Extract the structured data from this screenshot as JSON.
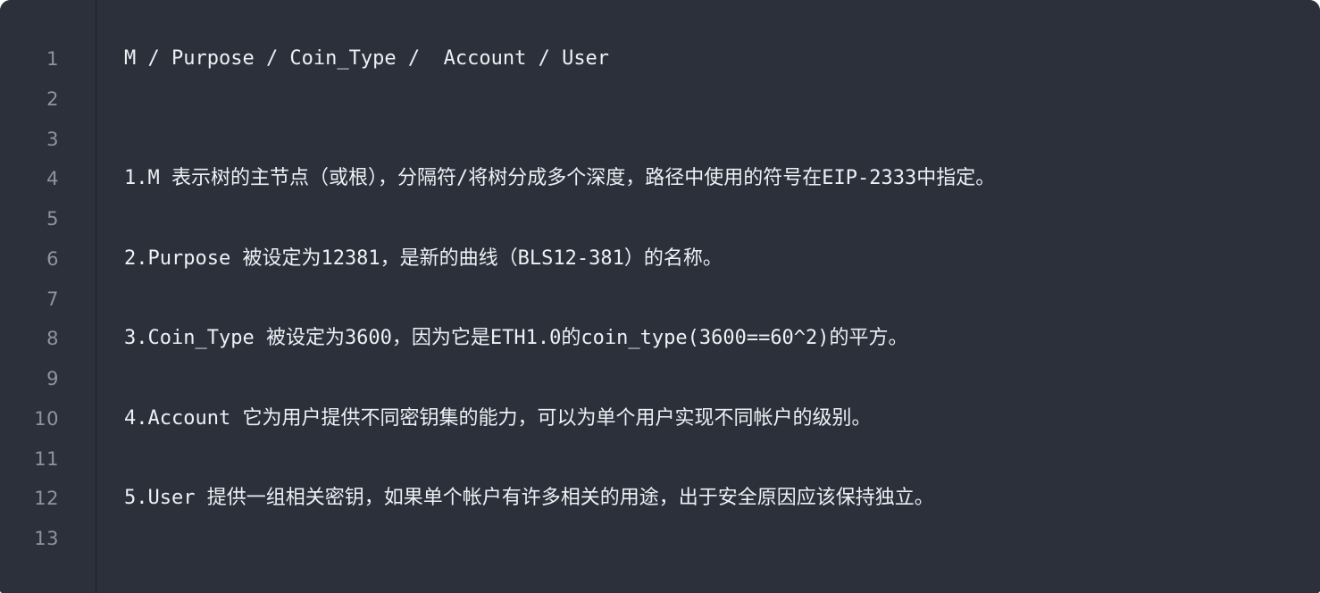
{
  "editor": {
    "background_color": "#2b303b",
    "gutter_divider_color": "#1b1f27",
    "text_color": "#edf0f4",
    "line_number_color": "#8d94a1",
    "gutter": {
      "line_numbers": [
        "1",
        "2",
        "3",
        "4",
        "5",
        "6",
        "7",
        "8",
        "9",
        "10",
        "11",
        "12",
        "13"
      ]
    },
    "lines": [
      {
        "number": "1",
        "text": "M / Purpose / Coin_Type /  Account / User"
      },
      {
        "number": "2",
        "text": ""
      },
      {
        "number": "3",
        "text": ""
      },
      {
        "number": "4",
        "text": "1.M 表示树的主节点（或根），分隔符/将树分成多个深度，路径中使用的符号在EIP-2333中指定。"
      },
      {
        "number": "5",
        "text": ""
      },
      {
        "number": "6",
        "text": "2.Purpose 被设定为12381，是新的曲线（BLS12-381）的名称。"
      },
      {
        "number": "7",
        "text": ""
      },
      {
        "number": "8",
        "text": "3.Coin_Type 被设定为3600，因为它是ETH1.0的coin_type(3600==60^2)的平方。"
      },
      {
        "number": "9",
        "text": ""
      },
      {
        "number": "10",
        "text": "4.Account 它为用户提供不同密钥集的能力，可以为单个用户实现不同帐户的级别。"
      },
      {
        "number": "11",
        "text": ""
      },
      {
        "number": "12",
        "text": "5.User 提供一组相关密钥，如果单个帐户有许多相关的用途，出于安全原因应该保持独立。"
      },
      {
        "number": "13",
        "text": ""
      }
    ]
  }
}
